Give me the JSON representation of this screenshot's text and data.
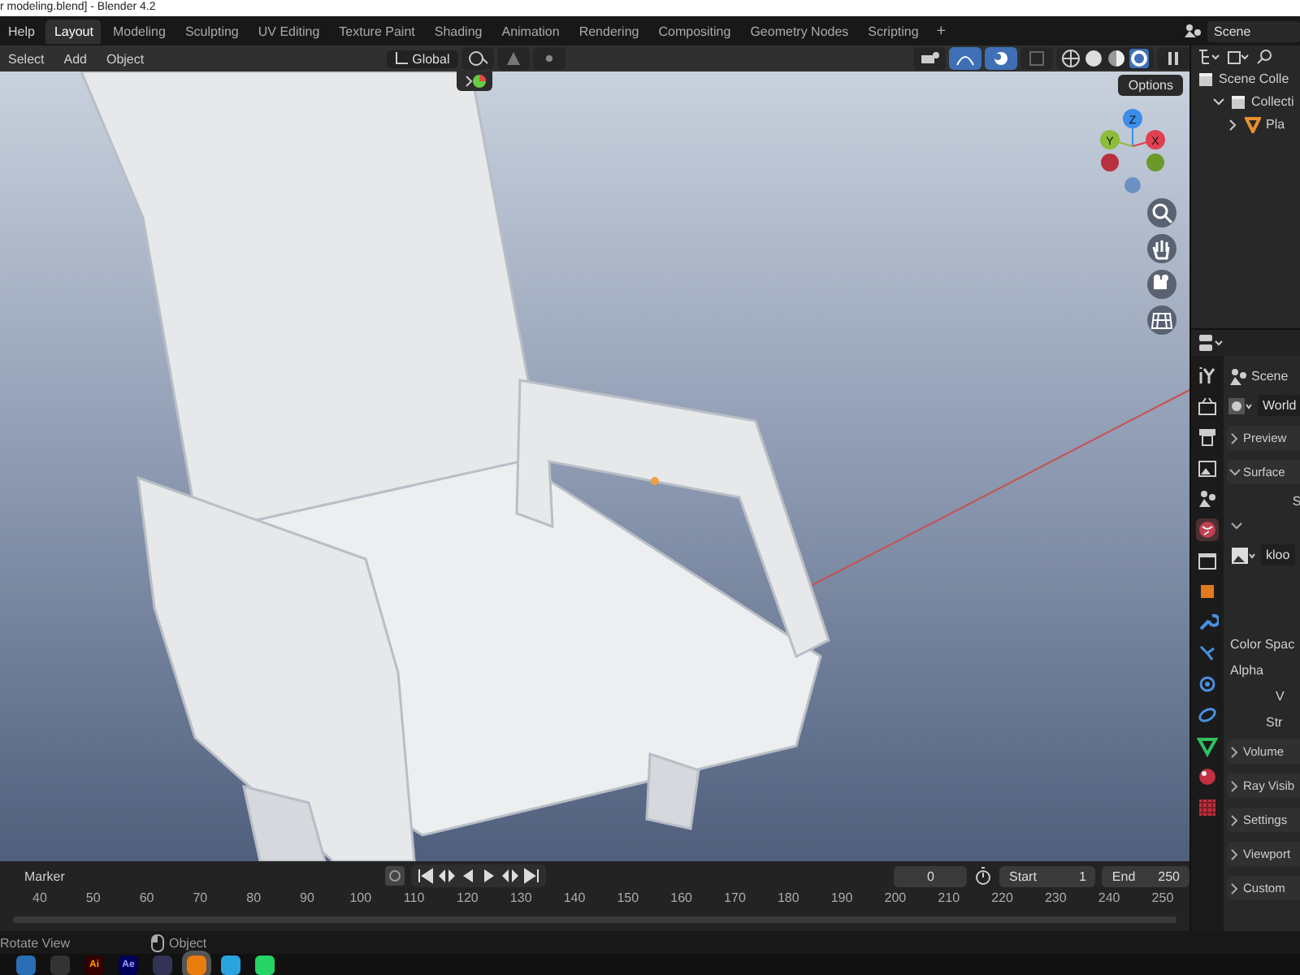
{
  "window": {
    "title": "r modeling.blend] - Blender 4.2"
  },
  "topbar": {
    "menu": "Help",
    "workspaces": [
      {
        "label": "Layout",
        "selected": true
      },
      {
        "label": "Modeling",
        "selected": false
      },
      {
        "label": "Sculpting",
        "selected": false
      },
      {
        "label": "UV Editing",
        "selected": false
      },
      {
        "label": "Texture Paint",
        "selected": false
      },
      {
        "label": "Shading",
        "selected": false
      },
      {
        "label": "Animation",
        "selected": false
      },
      {
        "label": "Rendering",
        "selected": false
      },
      {
        "label": "Compositing",
        "selected": false
      },
      {
        "label": "Geometry Nodes",
        "selected": false
      },
      {
        "label": "Scripting",
        "selected": false
      }
    ],
    "add_tab": "+",
    "scene": "Scene"
  },
  "viewport": {
    "menus": [
      "Select",
      "Add",
      "Object"
    ],
    "orientation": "Global",
    "options": "Options",
    "shading": [
      {
        "kind": "wireframe",
        "selected": false
      },
      {
        "kind": "solid",
        "selected": false
      },
      {
        "kind": "material",
        "selected": false
      },
      {
        "kind": "rendered",
        "selected": true
      }
    ],
    "gizmo": {
      "z": "Z",
      "y": "Y",
      "x": "X"
    }
  },
  "timeline": {
    "menu": "Marker",
    "current_frame": "0",
    "start_label": "Start",
    "start": "1",
    "end_label": "End",
    "end": "250",
    "ruler": [
      "40",
      "50",
      "60",
      "70",
      "80",
      "90",
      "100",
      "110",
      "120",
      "130",
      "140",
      "150",
      "160",
      "170",
      "180",
      "190",
      "200",
      "210",
      "220",
      "230",
      "240",
      "250"
    ]
  },
  "outliner": {
    "scene_collection": "Scene Colle",
    "children": [
      {
        "label": "Collecti",
        "expanded": true,
        "children": [
          {
            "label": "Pla",
            "expanded": false
          }
        ]
      }
    ]
  },
  "properties": {
    "tabs": [
      {
        "kind": "tool",
        "selected": false
      },
      {
        "kind": "render",
        "selected": false
      },
      {
        "kind": "output",
        "selected": false
      },
      {
        "kind": "view_layer",
        "selected": false
      },
      {
        "kind": "scene",
        "selected": false
      },
      {
        "kind": "world",
        "selected": true
      },
      {
        "kind": "collection",
        "selected": false
      },
      {
        "kind": "object",
        "selected": false
      },
      {
        "kind": "modifier",
        "selected": false
      },
      {
        "kind": "particles",
        "selected": false
      },
      {
        "kind": "physics",
        "selected": false
      },
      {
        "kind": "constraints",
        "selected": false
      },
      {
        "kind": "data",
        "selected": false
      },
      {
        "kind": "material",
        "selected": false
      },
      {
        "kind": "texture",
        "selected": false
      }
    ],
    "context": "Scene",
    "world": "World",
    "panels": [
      {
        "label": "Preview",
        "expanded": false
      },
      {
        "label": "Surface",
        "expanded": true,
        "surface_label": "S",
        "image": "kloo",
        "fields": [
          "Color Spac",
          "Alpha",
          "V",
          "Str"
        ]
      },
      {
        "label": "Volume",
        "expanded": false
      },
      {
        "label": "Ray Visib",
        "expanded": false
      },
      {
        "label": "Settings",
        "expanded": false
      },
      {
        "label": "Viewport",
        "expanded": false
      },
      {
        "label": "Custom",
        "expanded": false
      }
    ]
  },
  "status_bar": {
    "action": "Rotate View",
    "mode": "Object"
  },
  "taskbar": {
    "apps": [
      {
        "kind": "files",
        "selected": false
      },
      {
        "kind": "obs",
        "selected": false
      },
      {
        "kind": "illustrator",
        "label": "Ai",
        "selected": false
      },
      {
        "kind": "after_effects",
        "label": "Ae",
        "selected": false
      },
      {
        "kind": "browser",
        "selected": false
      },
      {
        "kind": "blender",
        "selected": true
      },
      {
        "kind": "telegram",
        "selected": false
      },
      {
        "kind": "whatsapp",
        "selected": false
      }
    ]
  }
}
